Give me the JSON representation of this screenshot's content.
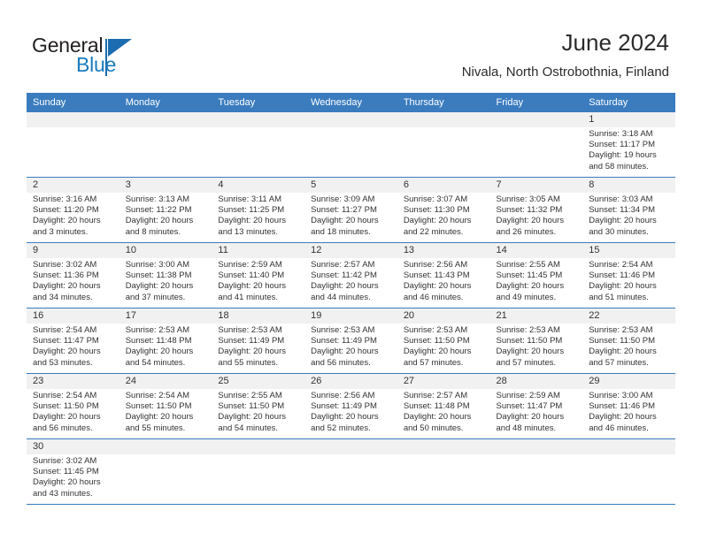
{
  "brand": {
    "name_top": "General",
    "name_bottom": "Blue",
    "accent_color": "#1b6cb0",
    "logo_icon": "flag-triangle-icon"
  },
  "header": {
    "title": "June 2024",
    "subtitle": "Nivala, North Ostrobothnia, Finland"
  },
  "theme": {
    "header_blue": "#3a7cbe",
    "daynum_band": "#f1f1f1",
    "text": "#333333"
  },
  "columns": [
    "Sunday",
    "Monday",
    "Tuesday",
    "Wednesday",
    "Thursday",
    "Friday",
    "Saturday"
  ],
  "weeks": [
    [
      {
        "day": "",
        "blank": true
      },
      {
        "day": "",
        "blank": true
      },
      {
        "day": "",
        "blank": true
      },
      {
        "day": "",
        "blank": true
      },
      {
        "day": "",
        "blank": true
      },
      {
        "day": "",
        "blank": true
      },
      {
        "day": "1",
        "sunrise": "Sunrise: 3:18 AM",
        "sunset": "Sunset: 11:17 PM",
        "daylight1": "Daylight: 19 hours",
        "daylight2": "and 58 minutes."
      }
    ],
    [
      {
        "day": "2",
        "sunrise": "Sunrise: 3:16 AM",
        "sunset": "Sunset: 11:20 PM",
        "daylight1": "Daylight: 20 hours",
        "daylight2": "and 3 minutes."
      },
      {
        "day": "3",
        "sunrise": "Sunrise: 3:13 AM",
        "sunset": "Sunset: 11:22 PM",
        "daylight1": "Daylight: 20 hours",
        "daylight2": "and 8 minutes."
      },
      {
        "day": "4",
        "sunrise": "Sunrise: 3:11 AM",
        "sunset": "Sunset: 11:25 PM",
        "daylight1": "Daylight: 20 hours",
        "daylight2": "and 13 minutes."
      },
      {
        "day": "5",
        "sunrise": "Sunrise: 3:09 AM",
        "sunset": "Sunset: 11:27 PM",
        "daylight1": "Daylight: 20 hours",
        "daylight2": "and 18 minutes."
      },
      {
        "day": "6",
        "sunrise": "Sunrise: 3:07 AM",
        "sunset": "Sunset: 11:30 PM",
        "daylight1": "Daylight: 20 hours",
        "daylight2": "and 22 minutes."
      },
      {
        "day": "7",
        "sunrise": "Sunrise: 3:05 AM",
        "sunset": "Sunset: 11:32 PM",
        "daylight1": "Daylight: 20 hours",
        "daylight2": "and 26 minutes."
      },
      {
        "day": "8",
        "sunrise": "Sunrise: 3:03 AM",
        "sunset": "Sunset: 11:34 PM",
        "daylight1": "Daylight: 20 hours",
        "daylight2": "and 30 minutes."
      }
    ],
    [
      {
        "day": "9",
        "sunrise": "Sunrise: 3:02 AM",
        "sunset": "Sunset: 11:36 PM",
        "daylight1": "Daylight: 20 hours",
        "daylight2": "and 34 minutes."
      },
      {
        "day": "10",
        "sunrise": "Sunrise: 3:00 AM",
        "sunset": "Sunset: 11:38 PM",
        "daylight1": "Daylight: 20 hours",
        "daylight2": "and 37 minutes."
      },
      {
        "day": "11",
        "sunrise": "Sunrise: 2:59 AM",
        "sunset": "Sunset: 11:40 PM",
        "daylight1": "Daylight: 20 hours",
        "daylight2": "and 41 minutes."
      },
      {
        "day": "12",
        "sunrise": "Sunrise: 2:57 AM",
        "sunset": "Sunset: 11:42 PM",
        "daylight1": "Daylight: 20 hours",
        "daylight2": "and 44 minutes."
      },
      {
        "day": "13",
        "sunrise": "Sunrise: 2:56 AM",
        "sunset": "Sunset: 11:43 PM",
        "daylight1": "Daylight: 20 hours",
        "daylight2": "and 46 minutes."
      },
      {
        "day": "14",
        "sunrise": "Sunrise: 2:55 AM",
        "sunset": "Sunset: 11:45 PM",
        "daylight1": "Daylight: 20 hours",
        "daylight2": "and 49 minutes."
      },
      {
        "day": "15",
        "sunrise": "Sunrise: 2:54 AM",
        "sunset": "Sunset: 11:46 PM",
        "daylight1": "Daylight: 20 hours",
        "daylight2": "and 51 minutes."
      }
    ],
    [
      {
        "day": "16",
        "sunrise": "Sunrise: 2:54 AM",
        "sunset": "Sunset: 11:47 PM",
        "daylight1": "Daylight: 20 hours",
        "daylight2": "and 53 minutes."
      },
      {
        "day": "17",
        "sunrise": "Sunrise: 2:53 AM",
        "sunset": "Sunset: 11:48 PM",
        "daylight1": "Daylight: 20 hours",
        "daylight2": "and 54 minutes."
      },
      {
        "day": "18",
        "sunrise": "Sunrise: 2:53 AM",
        "sunset": "Sunset: 11:49 PM",
        "daylight1": "Daylight: 20 hours",
        "daylight2": "and 55 minutes."
      },
      {
        "day": "19",
        "sunrise": "Sunrise: 2:53 AM",
        "sunset": "Sunset: 11:49 PM",
        "daylight1": "Daylight: 20 hours",
        "daylight2": "and 56 minutes."
      },
      {
        "day": "20",
        "sunrise": "Sunrise: 2:53 AM",
        "sunset": "Sunset: 11:50 PM",
        "daylight1": "Daylight: 20 hours",
        "daylight2": "and 57 minutes."
      },
      {
        "day": "21",
        "sunrise": "Sunrise: 2:53 AM",
        "sunset": "Sunset: 11:50 PM",
        "daylight1": "Daylight: 20 hours",
        "daylight2": "and 57 minutes."
      },
      {
        "day": "22",
        "sunrise": "Sunrise: 2:53 AM",
        "sunset": "Sunset: 11:50 PM",
        "daylight1": "Daylight: 20 hours",
        "daylight2": "and 57 minutes."
      }
    ],
    [
      {
        "day": "23",
        "sunrise": "Sunrise: 2:54 AM",
        "sunset": "Sunset: 11:50 PM",
        "daylight1": "Daylight: 20 hours",
        "daylight2": "and 56 minutes."
      },
      {
        "day": "24",
        "sunrise": "Sunrise: 2:54 AM",
        "sunset": "Sunset: 11:50 PM",
        "daylight1": "Daylight: 20 hours",
        "daylight2": "and 55 minutes."
      },
      {
        "day": "25",
        "sunrise": "Sunrise: 2:55 AM",
        "sunset": "Sunset: 11:50 PM",
        "daylight1": "Daylight: 20 hours",
        "daylight2": "and 54 minutes."
      },
      {
        "day": "26",
        "sunrise": "Sunrise: 2:56 AM",
        "sunset": "Sunset: 11:49 PM",
        "daylight1": "Daylight: 20 hours",
        "daylight2": "and 52 minutes."
      },
      {
        "day": "27",
        "sunrise": "Sunrise: 2:57 AM",
        "sunset": "Sunset: 11:48 PM",
        "daylight1": "Daylight: 20 hours",
        "daylight2": "and 50 minutes."
      },
      {
        "day": "28",
        "sunrise": "Sunrise: 2:59 AM",
        "sunset": "Sunset: 11:47 PM",
        "daylight1": "Daylight: 20 hours",
        "daylight2": "and 48 minutes."
      },
      {
        "day": "29",
        "sunrise": "Sunrise: 3:00 AM",
        "sunset": "Sunset: 11:46 PM",
        "daylight1": "Daylight: 20 hours",
        "daylight2": "and 46 minutes."
      }
    ],
    [
      {
        "day": "30",
        "sunrise": "Sunrise: 3:02 AM",
        "sunset": "Sunset: 11:45 PM",
        "daylight1": "Daylight: 20 hours",
        "daylight2": "and 43 minutes."
      },
      {
        "day": "",
        "blank": true
      },
      {
        "day": "",
        "blank": true
      },
      {
        "day": "",
        "blank": true
      },
      {
        "day": "",
        "blank": true
      },
      {
        "day": "",
        "blank": true
      },
      {
        "day": "",
        "blank": true
      }
    ]
  ]
}
